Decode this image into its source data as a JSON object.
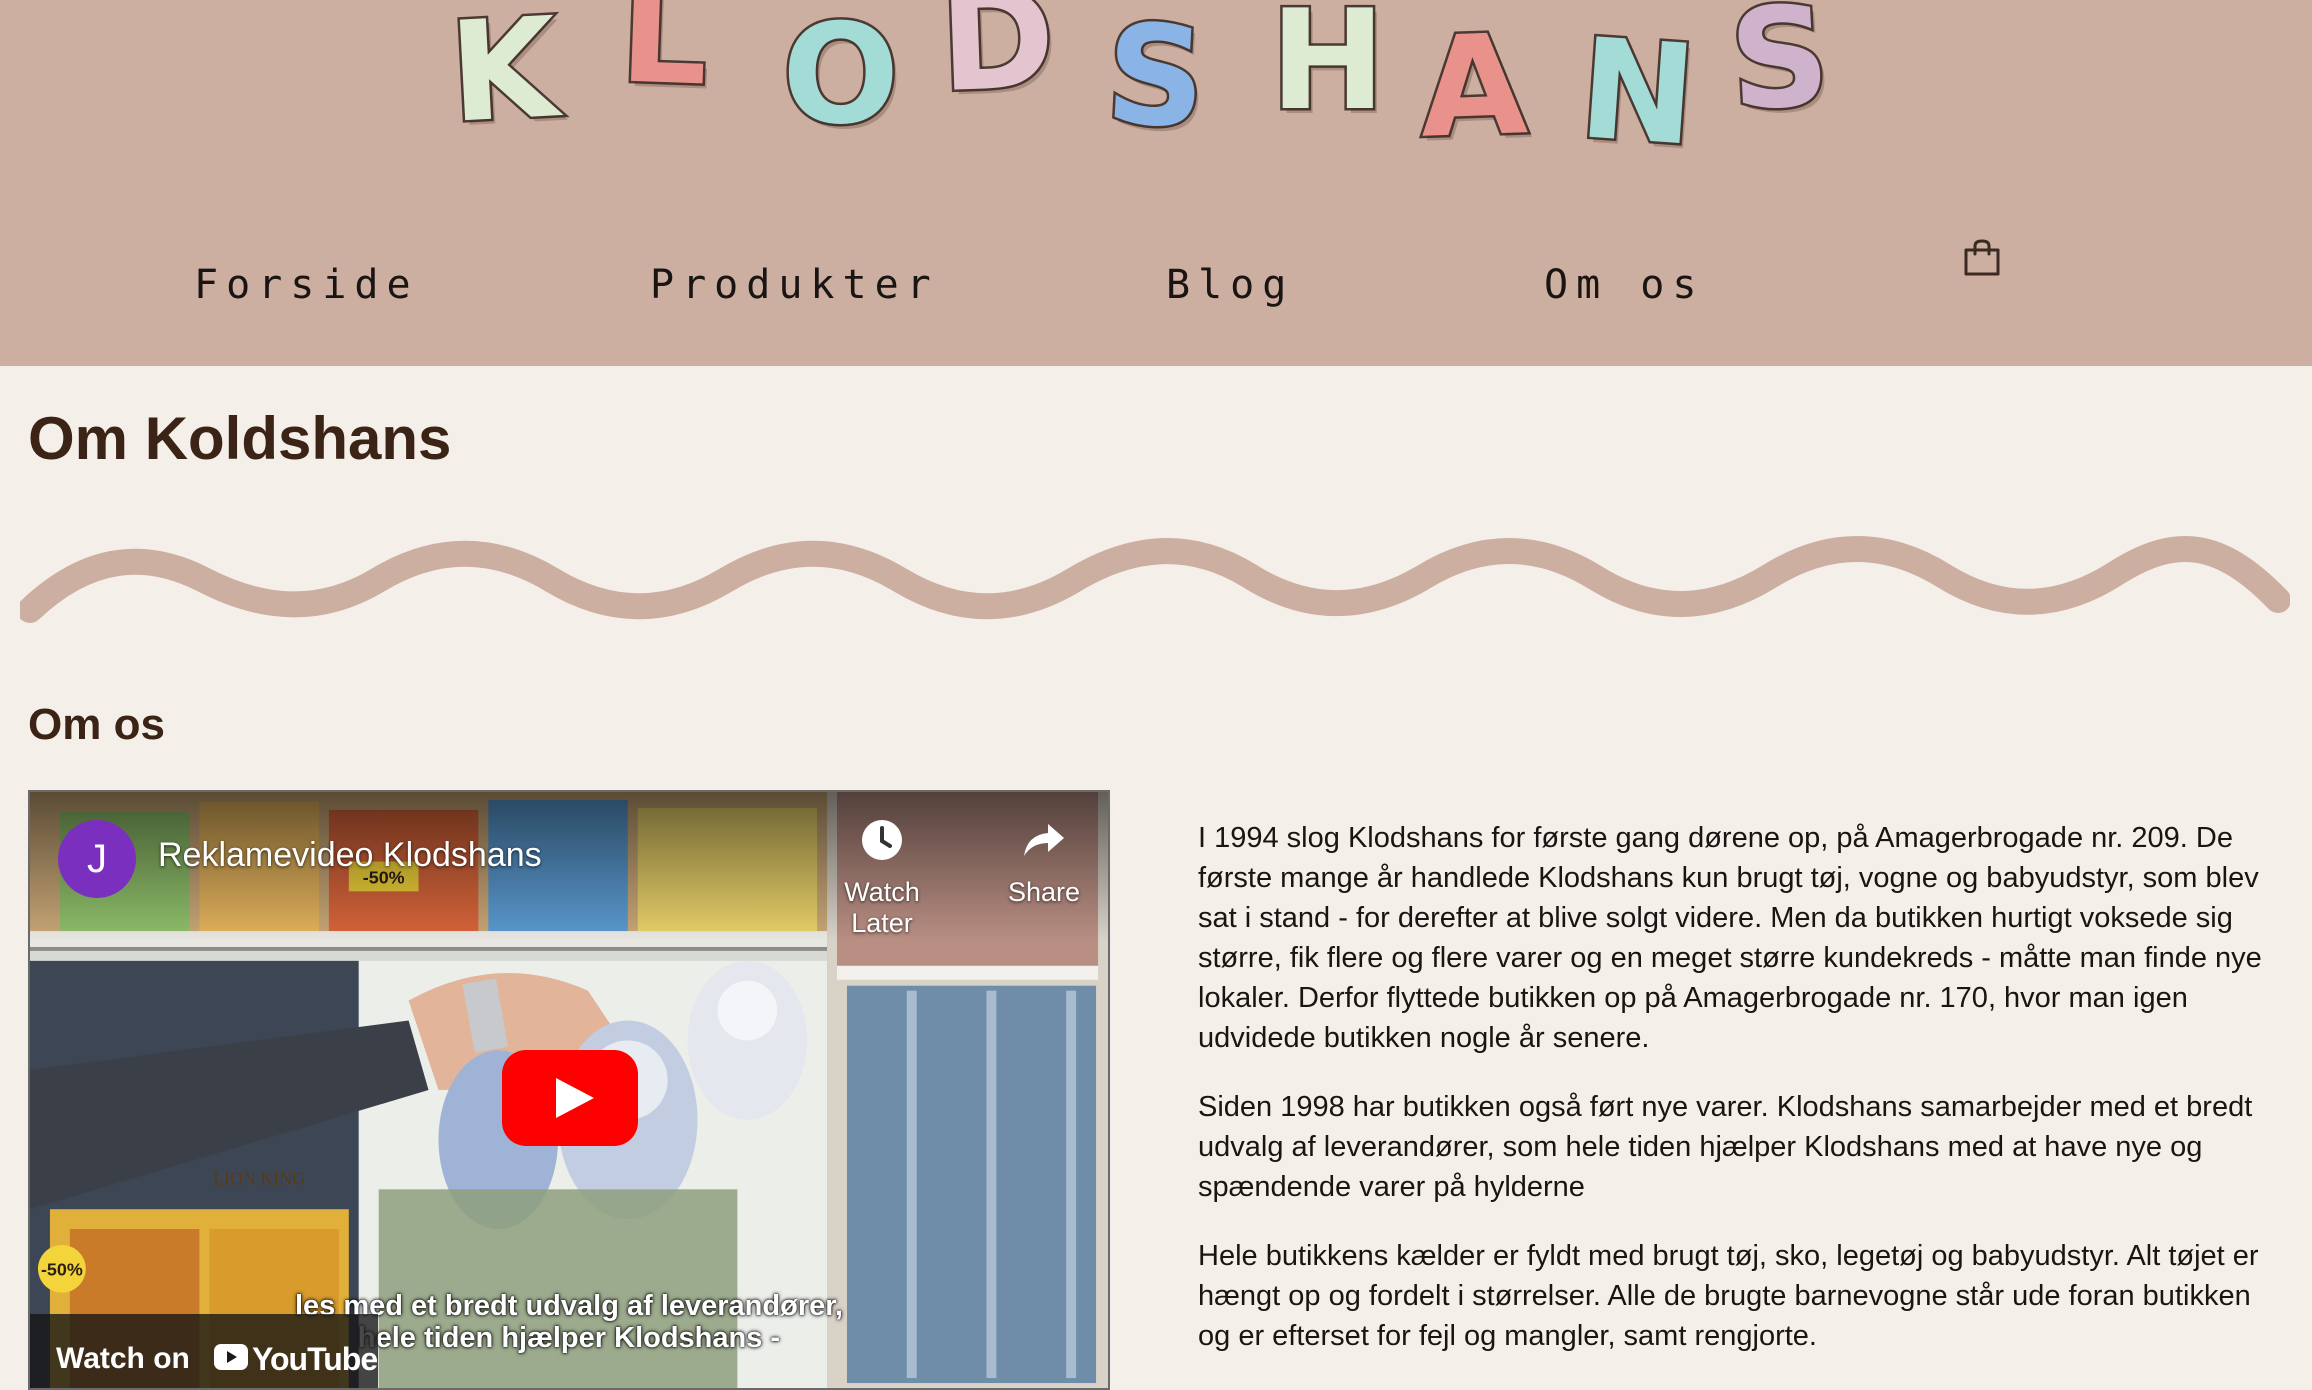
{
  "header": {
    "logo_letters": [
      {
        "char": "K",
        "color": "#dcebd2"
      },
      {
        "char": "L",
        "color": "#e9928b"
      },
      {
        "char": "O",
        "color": "#a3dbd6"
      },
      {
        "char": "D",
        "color": "#e3c4cf"
      },
      {
        "char": "S",
        "color": "#8ab4e6"
      },
      {
        "char": "H",
        "color": "#dcebd2"
      },
      {
        "char": "A",
        "color": "#e9928b"
      },
      {
        "char": "N",
        "color": "#a3dbd6"
      },
      {
        "char": "S",
        "color": "#cfb3cc"
      }
    ],
    "nav": [
      {
        "label": "Forside"
      },
      {
        "label": "Produkter"
      },
      {
        "label": "Blog"
      },
      {
        "label": "Om os"
      }
    ],
    "cart_icon": "shopping-bag-icon"
  },
  "main": {
    "page_title": "Om Koldshans",
    "section_title": "Om os",
    "divider_color": "#ccafa0",
    "video": {
      "channel_initial": "J",
      "title": "Reklamevideo Klodshans",
      "watch_later": "Watch Later",
      "share": "Share",
      "subtitle_line1": "les med et bredt udvalg af leverandører,",
      "subtitle_line2": "hele tiden hjælper Klodshans -",
      "watch_on": "Watch on",
      "platform": "YouTube",
      "sign_discount": "-50%",
      "box_label": "LION KING"
    },
    "paragraphs": [
      "I 1994 slog Klodshans for første gang dørene op, på Amagerbrogade nr. 209. De første mange år handlede Klodshans kun brugt tøj, vogne og babyudstyr, som blev sat i stand - for derefter at blive solgt videre. Men da butikken hurtigt voksede sig større, fik flere og flere varer og en meget større kundekreds - måtte man finde nye lokaler. Derfor flyttede butikken op på Amagerbrogade nr. 170, hvor man igen udvidede butikken nogle år senere.",
      "Siden 1998 har butikken også ført nye varer. Klodshans samarbejder med et bredt udvalg af leverandører, som hele tiden hjælper Klodshans med at have nye og spændende varer på hylderne",
      "Hele butikkens kælder er fyldt med brugt tøj, sko, legetøj og babyudstyr. Alt tøjet er hængt op og fordelt i størrelser. Alle de brugte barnevogne står ude foran butikken og er efterset for fejl og mangler, samt rengjorte."
    ]
  }
}
